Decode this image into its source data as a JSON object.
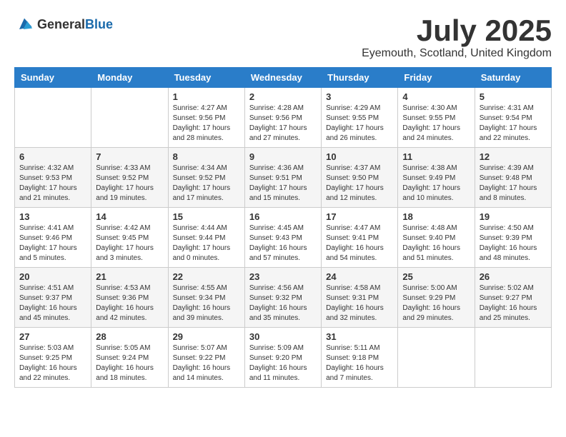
{
  "header": {
    "logo_general": "General",
    "logo_blue": "Blue",
    "month_title": "July 2025",
    "location": "Eyemouth, Scotland, United Kingdom"
  },
  "days_of_week": [
    "Sunday",
    "Monday",
    "Tuesday",
    "Wednesday",
    "Thursday",
    "Friday",
    "Saturday"
  ],
  "weeks": [
    [
      {
        "day": "",
        "info": ""
      },
      {
        "day": "",
        "info": ""
      },
      {
        "day": "1",
        "info": "Sunrise: 4:27 AM\nSunset: 9:56 PM\nDaylight: 17 hours and 28 minutes."
      },
      {
        "day": "2",
        "info": "Sunrise: 4:28 AM\nSunset: 9:56 PM\nDaylight: 17 hours and 27 minutes."
      },
      {
        "day": "3",
        "info": "Sunrise: 4:29 AM\nSunset: 9:55 PM\nDaylight: 17 hours and 26 minutes."
      },
      {
        "day": "4",
        "info": "Sunrise: 4:30 AM\nSunset: 9:55 PM\nDaylight: 17 hours and 24 minutes."
      },
      {
        "day": "5",
        "info": "Sunrise: 4:31 AM\nSunset: 9:54 PM\nDaylight: 17 hours and 22 minutes."
      }
    ],
    [
      {
        "day": "6",
        "info": "Sunrise: 4:32 AM\nSunset: 9:53 PM\nDaylight: 17 hours and 21 minutes."
      },
      {
        "day": "7",
        "info": "Sunrise: 4:33 AM\nSunset: 9:52 PM\nDaylight: 17 hours and 19 minutes."
      },
      {
        "day": "8",
        "info": "Sunrise: 4:34 AM\nSunset: 9:52 PM\nDaylight: 17 hours and 17 minutes."
      },
      {
        "day": "9",
        "info": "Sunrise: 4:36 AM\nSunset: 9:51 PM\nDaylight: 17 hours and 15 minutes."
      },
      {
        "day": "10",
        "info": "Sunrise: 4:37 AM\nSunset: 9:50 PM\nDaylight: 17 hours and 12 minutes."
      },
      {
        "day": "11",
        "info": "Sunrise: 4:38 AM\nSunset: 9:49 PM\nDaylight: 17 hours and 10 minutes."
      },
      {
        "day": "12",
        "info": "Sunrise: 4:39 AM\nSunset: 9:48 PM\nDaylight: 17 hours and 8 minutes."
      }
    ],
    [
      {
        "day": "13",
        "info": "Sunrise: 4:41 AM\nSunset: 9:46 PM\nDaylight: 17 hours and 5 minutes."
      },
      {
        "day": "14",
        "info": "Sunrise: 4:42 AM\nSunset: 9:45 PM\nDaylight: 17 hours and 3 minutes."
      },
      {
        "day": "15",
        "info": "Sunrise: 4:44 AM\nSunset: 9:44 PM\nDaylight: 17 hours and 0 minutes."
      },
      {
        "day": "16",
        "info": "Sunrise: 4:45 AM\nSunset: 9:43 PM\nDaylight: 16 hours and 57 minutes."
      },
      {
        "day": "17",
        "info": "Sunrise: 4:47 AM\nSunset: 9:41 PM\nDaylight: 16 hours and 54 minutes."
      },
      {
        "day": "18",
        "info": "Sunrise: 4:48 AM\nSunset: 9:40 PM\nDaylight: 16 hours and 51 minutes."
      },
      {
        "day": "19",
        "info": "Sunrise: 4:50 AM\nSunset: 9:39 PM\nDaylight: 16 hours and 48 minutes."
      }
    ],
    [
      {
        "day": "20",
        "info": "Sunrise: 4:51 AM\nSunset: 9:37 PM\nDaylight: 16 hours and 45 minutes."
      },
      {
        "day": "21",
        "info": "Sunrise: 4:53 AM\nSunset: 9:36 PM\nDaylight: 16 hours and 42 minutes."
      },
      {
        "day": "22",
        "info": "Sunrise: 4:55 AM\nSunset: 9:34 PM\nDaylight: 16 hours and 39 minutes."
      },
      {
        "day": "23",
        "info": "Sunrise: 4:56 AM\nSunset: 9:32 PM\nDaylight: 16 hours and 35 minutes."
      },
      {
        "day": "24",
        "info": "Sunrise: 4:58 AM\nSunset: 9:31 PM\nDaylight: 16 hours and 32 minutes."
      },
      {
        "day": "25",
        "info": "Sunrise: 5:00 AM\nSunset: 9:29 PM\nDaylight: 16 hours and 29 minutes."
      },
      {
        "day": "26",
        "info": "Sunrise: 5:02 AM\nSunset: 9:27 PM\nDaylight: 16 hours and 25 minutes."
      }
    ],
    [
      {
        "day": "27",
        "info": "Sunrise: 5:03 AM\nSunset: 9:25 PM\nDaylight: 16 hours and 22 minutes."
      },
      {
        "day": "28",
        "info": "Sunrise: 5:05 AM\nSunset: 9:24 PM\nDaylight: 16 hours and 18 minutes."
      },
      {
        "day": "29",
        "info": "Sunrise: 5:07 AM\nSunset: 9:22 PM\nDaylight: 16 hours and 14 minutes."
      },
      {
        "day": "30",
        "info": "Sunrise: 5:09 AM\nSunset: 9:20 PM\nDaylight: 16 hours and 11 minutes."
      },
      {
        "day": "31",
        "info": "Sunrise: 5:11 AM\nSunset: 9:18 PM\nDaylight: 16 hours and 7 minutes."
      },
      {
        "day": "",
        "info": ""
      },
      {
        "day": "",
        "info": ""
      }
    ]
  ]
}
